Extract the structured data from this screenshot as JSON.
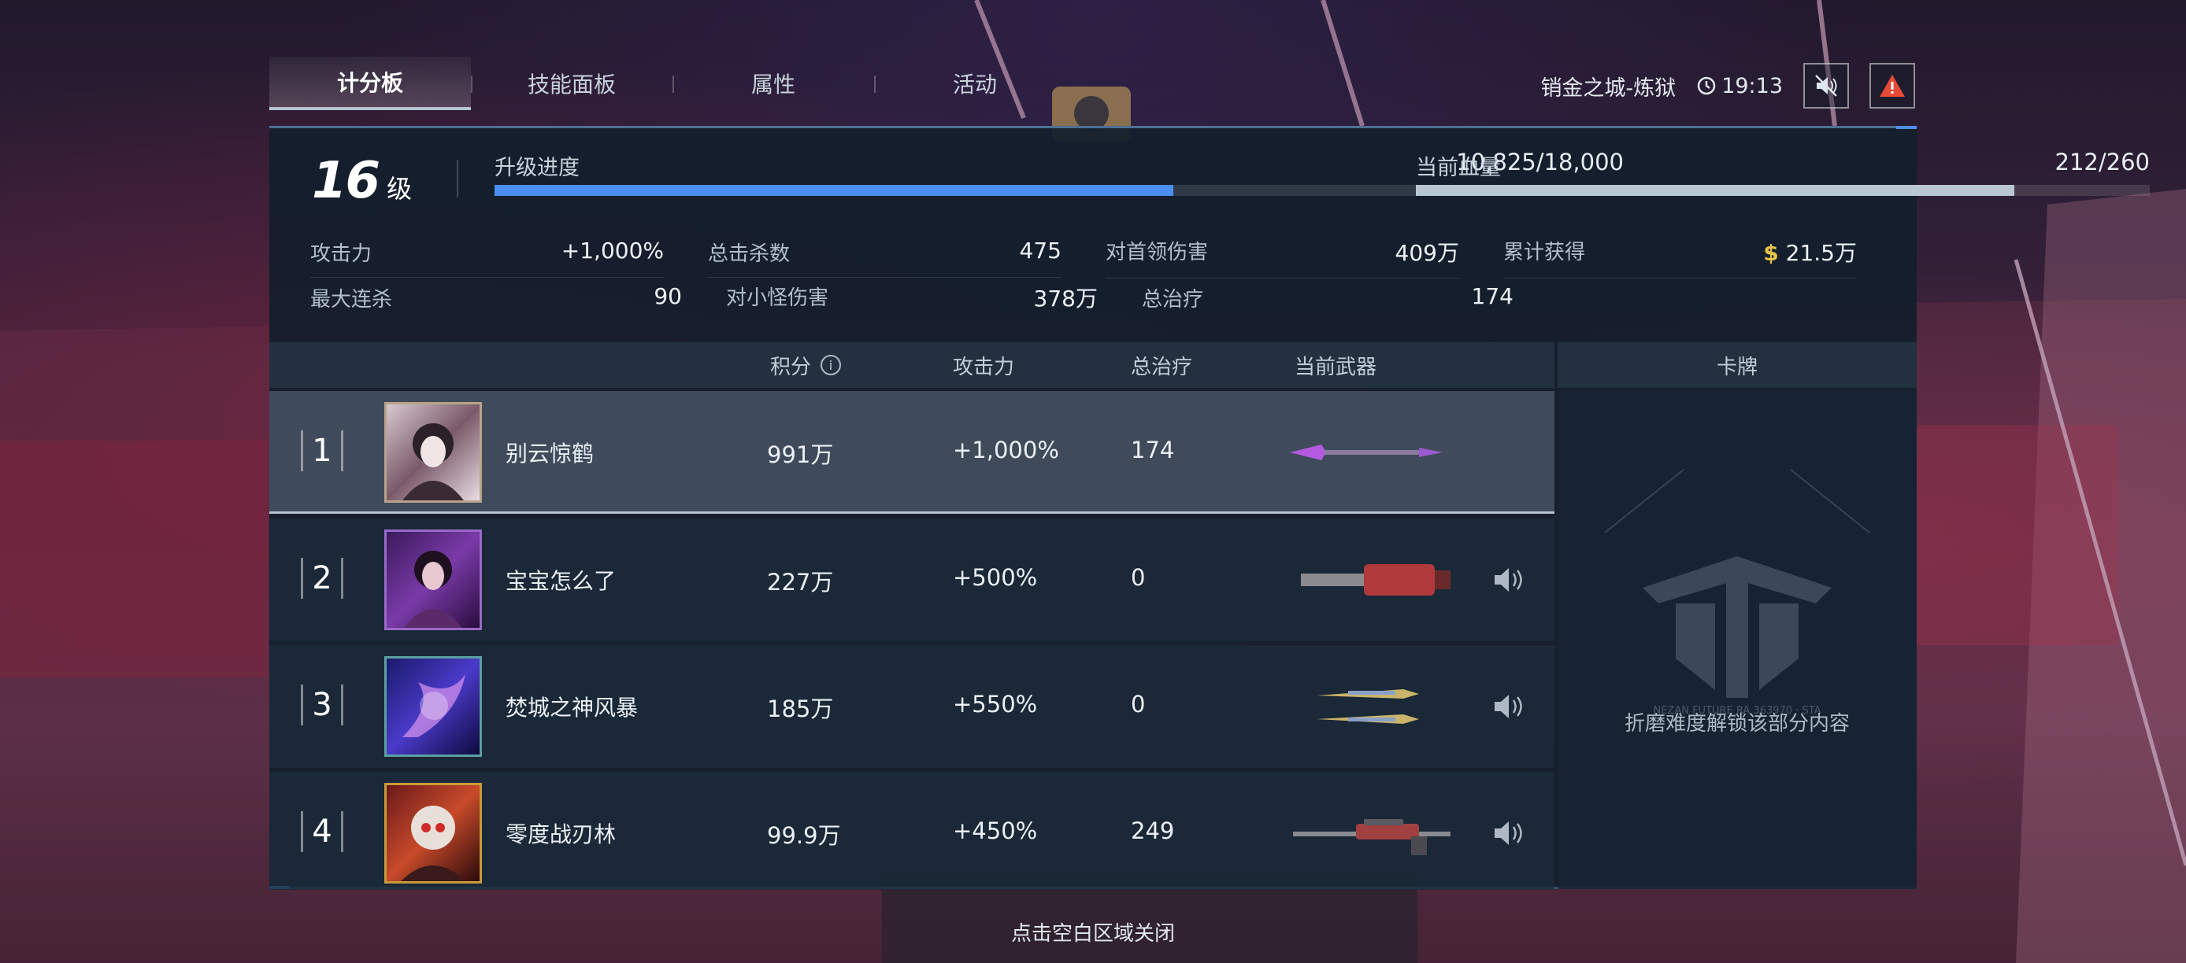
{
  "tabs": [
    "计分板",
    "技能面板",
    "属性",
    "活动"
  ],
  "status": {
    "map": "销金之城-炼狱",
    "time": "19:13"
  },
  "level": {
    "value": "16",
    "unit": "级"
  },
  "upgrade": {
    "label": "升级进度",
    "text": "10,825/18,000",
    "progress": 0.6014
  },
  "health": {
    "label": "当前血量",
    "text": "212/260",
    "progress": 0.8154
  },
  "stats": [
    [
      {
        "k": "攻击力",
        "v": "+1,000%"
      },
      {
        "k": "总击杀数",
        "v": "475"
      },
      {
        "k": "对首领伤害",
        "v": "409万"
      },
      {
        "k": "累计获得",
        "v": "21.5万",
        "prefix": "$"
      }
    ],
    [
      {
        "k": "最大连杀",
        "v": "90"
      },
      {
        "k": "对小怪伤害",
        "v": "378万"
      },
      {
        "k": "总治疗",
        "v": "174"
      }
    ]
  ],
  "table": {
    "headers": {
      "score": "积分",
      "info": "i",
      "atk": "攻击力",
      "heal": "总治疗",
      "weapon": "当前武器",
      "cards": "卡牌"
    },
    "rows": [
      {
        "rank": "1",
        "name": "别云惊鹤",
        "score": "991万",
        "atk": "+1,000%",
        "heal": "174"
      },
      {
        "rank": "2",
        "name": "宝宝怎么了",
        "score": "227万",
        "atk": "+500%",
        "heal": "0"
      },
      {
        "rank": "3",
        "name": "焚城之神风暴",
        "score": "185万",
        "atk": "+550%",
        "heal": "0"
      },
      {
        "rank": "4",
        "name": "零度战刃林",
        "score": "99.9万",
        "atk": "+450%",
        "heal": "249"
      }
    ]
  },
  "cards": {
    "locked_text": "折磨难度解锁该部分内容",
    "watermark": "NEZAN FUTURE RA 363970 · STA"
  },
  "close_hint": "点击空白区域关闭",
  "colors": {
    "accent": "#4c8df0",
    "gold": "#e8c34a",
    "alert": "#e84a3a"
  }
}
